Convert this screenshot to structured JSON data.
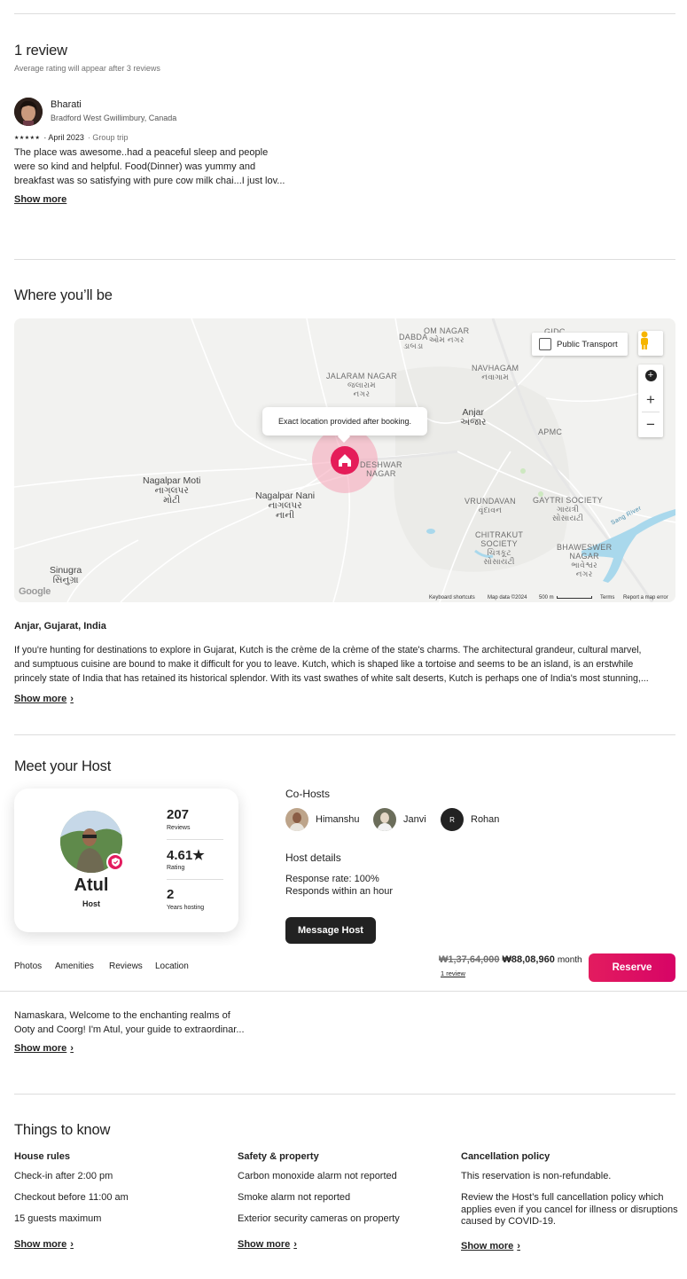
{
  "reviews": {
    "title": "1 review",
    "subtitle": "Average rating will appear after 3 reviews",
    "items": [
      {
        "name": "Bharati",
        "location": "Bradford West Gwillimbury, Canada",
        "stars": "★★★★★",
        "date": "· April 2023",
        "trip": "· Group trip",
        "text_lines": [
          "The place was awesome..had a peaceful sleep and people",
          "were so kind and helpful. Food(Dinner) was yummy and",
          "breakfast was so satisfying with pure cow milk chai...I just lov..."
        ],
        "show_more": "Show more"
      }
    ]
  },
  "location": {
    "title": "Where you’ll be",
    "map": {
      "tooltip": "Exact location provided after booking.",
      "public_transport": "Public Transport",
      "zoom_in": "+",
      "zoom_out": "−",
      "labels": {
        "om_nagar": "OM NAGAR",
        "om_nagar_local": "ઓમ નગર",
        "dabda": "DABDA",
        "dabda_local": "ડાબડા",
        "gidc": "GIDC",
        "jalaram_nagar": "JALARAM NAGAR",
        "jalaram_nagar_local": "જલારામ",
        "jalaram_nagar_local2": "નગર",
        "navhagam": "NAVHAGAM",
        "navhagam_local": "નવાગામ",
        "anjar": "Anjar",
        "anjar_local": "અંજાર",
        "apmc": "APMC",
        "nagalpar_moti": "Nagalpar Moti",
        "nagalpar_moti_local": "નાગલપર",
        "nagalpar_moti_local2": "મોટી",
        "nagalpar_nani": "Nagalpar Nani",
        "nagalpar_nani_local": "નાગલપર",
        "nagalpar_nani_local2": "નાની",
        "deshwar": "DESHWAR",
        "deshwar2": "NAGAR",
        "vrundavan": "VRUNDAVAN",
        "vrundavan_local": "વૃંદાવન",
        "gaytri": "GAYTRI SOCIETY",
        "gaytri_local": "ગાયત્રી",
        "gaytri_local2": "સોસાયટી",
        "chitrakut": "CHITRAKUT",
        "chitrakut2": "SOCIETY",
        "chitrakut_local": "ચિત્રકૂટ",
        "chitrakut_local2": "સોસાયટી",
        "bhaweswer": "BHAWESWER",
        "bhaweswer2": "NAGAR",
        "bhaweswer_local": "ભાવેશ્વર",
        "bhaweswer_local2": "નગર",
        "sinugra": "Sinugra",
        "sinugra_local": "સિનુગ્રા",
        "river": "Sang River"
      },
      "google": "Google",
      "footer": {
        "shortcuts": "Keyboard shortcuts",
        "map_data": "Map data ©2024",
        "scale": "500 m",
        "terms": "Terms",
        "report": "Report a map error"
      }
    },
    "place": "Anjar, Gujarat, India",
    "description_lines": [
      "If you're hunting for destinations to explore in Gujarat, Kutch is the crème de la crème of the state's charms. The architectural grandeur, cultural marvel,",
      "and sumptuous cuisine are bound to make it difficult for you to leave. Kutch, which is shaped like a tortoise and seems to be an island, is an erstwhile",
      "princely state of India that has retained its historical splendor. With its vast swathes of white salt deserts, Kutch is perhaps one of India's most stunning,..."
    ],
    "show_more": "Show more"
  },
  "host": {
    "title": "Meet your Host",
    "name": "Atul",
    "role": "Host",
    "stats": [
      {
        "value": "207",
        "label": "Reviews"
      },
      {
        "value": "4.61★",
        "label": "Rating"
      },
      {
        "value": "2",
        "label": "Years hosting"
      }
    ],
    "cohosts_title": "Co-Hosts",
    "cohosts": [
      {
        "name": "Himanshu"
      },
      {
        "name": "Janvi"
      },
      {
        "name": "Rohan",
        "initial": "R"
      }
    ],
    "details_title": "Host details",
    "response_rate": "Response rate: 100%",
    "response_time": "Responds within an hour",
    "message_button": "Message Host",
    "bio_lines": [
      "Namaskara, Welcome to the enchanting realms of",
      "Ooty and Coorg! I'm Atul, your guide to extraordinar..."
    ],
    "show_more": "Show more"
  },
  "sticky_bar": {
    "nav": [
      "Photos",
      "Amenities",
      "Reviews",
      "Location"
    ],
    "old_price": "₩1,37,64,000",
    "price": "₩88,08,960",
    "period": "month",
    "reviews_link": "1 review",
    "reserve": "Reserve",
    "brand_color": "#E31C5F"
  },
  "things": {
    "title": "Things to know",
    "columns": [
      {
        "title": "House rules",
        "items": [
          "Check-in after 2:00 pm",
          "Checkout before 11:00 am",
          "15 guests maximum"
        ],
        "show_more": "Show more"
      },
      {
        "title": "Safety & property",
        "items": [
          "Carbon monoxide alarm not reported",
          "Smoke alarm not reported",
          "Exterior security cameras on property"
        ],
        "show_more": "Show more"
      },
      {
        "title": "Cancellation policy",
        "items": [
          "This reservation is non-refundable.",
          "Review the Host’s full cancellation policy which applies even if you cancel for illness or disruptions caused by COVID-19."
        ],
        "show_more": "Show more"
      }
    ]
  }
}
